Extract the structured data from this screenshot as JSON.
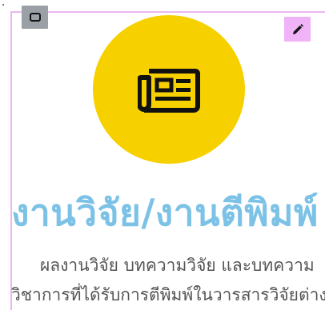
{
  "toolbar": {
    "select_icon": "rectangle-select-icon",
    "edit_icon": "pencil-icon",
    "edit_color": "#f0b3f7",
    "select_color": "#9aa0a6"
  },
  "hero": {
    "icon": "newspaper-icon",
    "circle_color": "#f7d000",
    "title": "งานวิจัย/งานตีพิมพ์",
    "title_color": "#7cc1e6",
    "description_line1": "ผลงานวิจัย บทความวิจัย และบทความ",
    "description_line2": "วิชาการที่ได้รับการตีพิมพ์ในวารสารวิจัยต่าง ๆ"
  }
}
